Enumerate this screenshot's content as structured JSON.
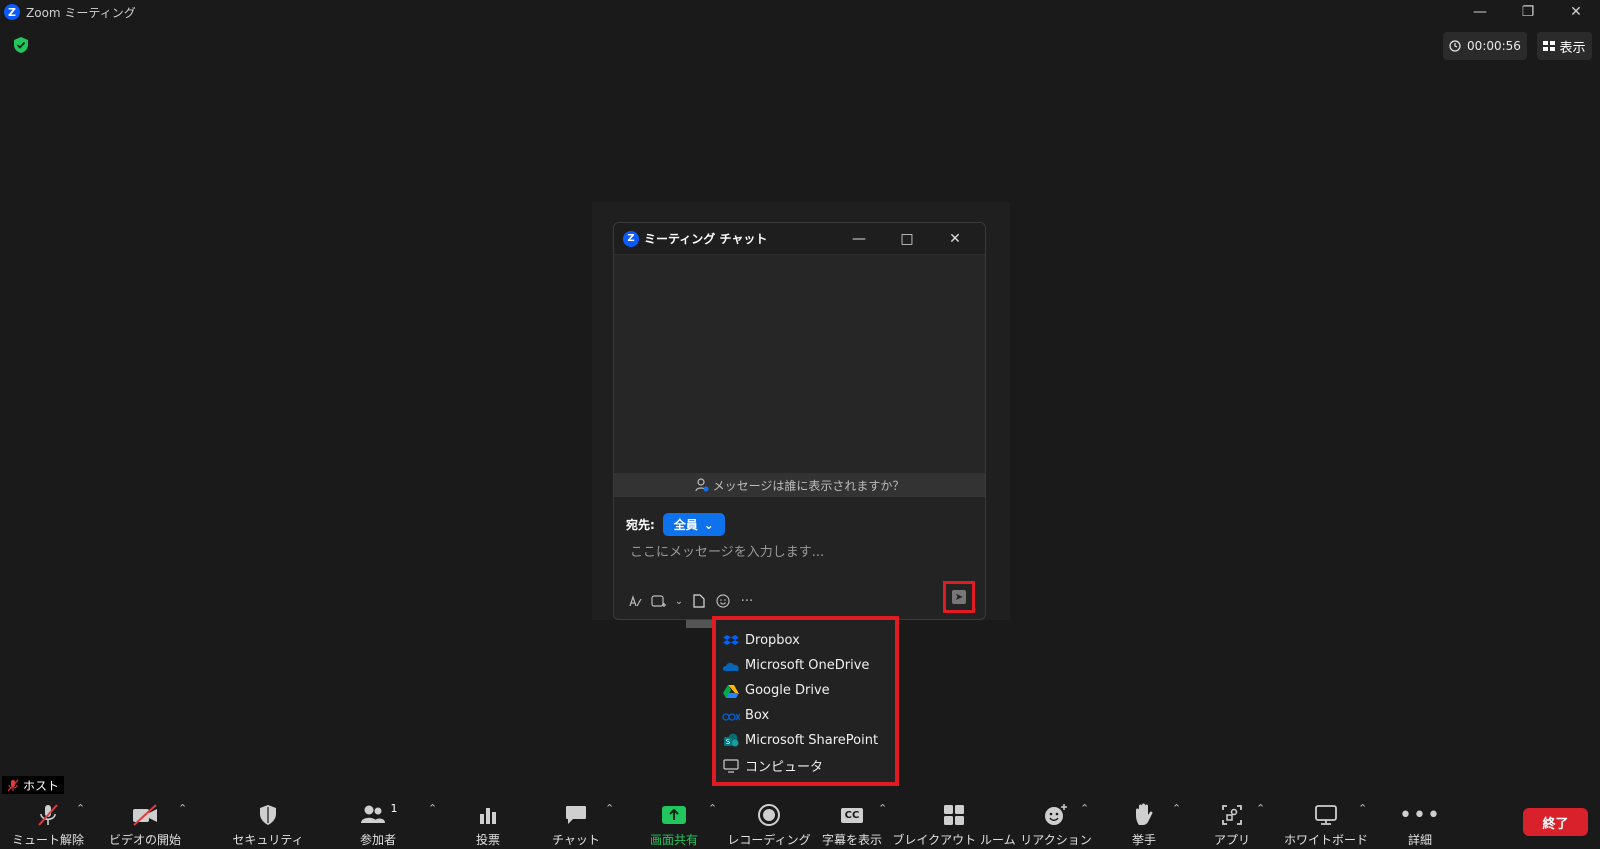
{
  "window": {
    "title": "Zoom ミーティング",
    "logo_letter": "Z",
    "min": "—",
    "restore": "❐",
    "close": "✕"
  },
  "top_right": {
    "timer": "00:00:56",
    "view_label": "表示"
  },
  "chat": {
    "title": "ミーティング チャット",
    "min": "—",
    "max": "□",
    "close": "✕",
    "visibility_text": "メッセージは誰に表示されますか？",
    "to_label": "宛先:",
    "to_value": "全員",
    "input_placeholder": "ここにメッセージを入力します...",
    "send_icon": "send-icon"
  },
  "file_menu": {
    "items": [
      {
        "label": "Dropbox",
        "icon": "dropbox-icon"
      },
      {
        "label": "Microsoft OneDrive",
        "icon": "onedrive-icon"
      },
      {
        "label": "Google Drive",
        "icon": "google-drive-icon"
      },
      {
        "label": "Box",
        "icon": "box-icon"
      },
      {
        "label": "Microsoft SharePoint",
        "icon": "sharepoint-icon"
      },
      {
        "label": "コンピュータ",
        "icon": "computer-icon"
      }
    ]
  },
  "host_badge": "ホスト",
  "toolbar": {
    "mute": "ミュート解除",
    "video": "ビデオの開始",
    "security": "セキュリティ",
    "participants": "参加者",
    "participants_count": "1",
    "polls": "投票",
    "chat": "チャット",
    "share": "画面共有",
    "record": "レコーディング",
    "captions": "字幕を表示",
    "captions_cc": "CC",
    "breakout": "ブレイクアウト ルーム",
    "reactions": "リアクション",
    "raise_hand": "挙手",
    "apps": "アプリ",
    "whiteboard": "ホワイトボード",
    "more": "詳細",
    "end": "終了"
  },
  "colors": {
    "accent_blue": "#0e72ed",
    "share_green": "#22c55e",
    "end_red": "#d8212a",
    "highlight_red": "#e01b24"
  }
}
